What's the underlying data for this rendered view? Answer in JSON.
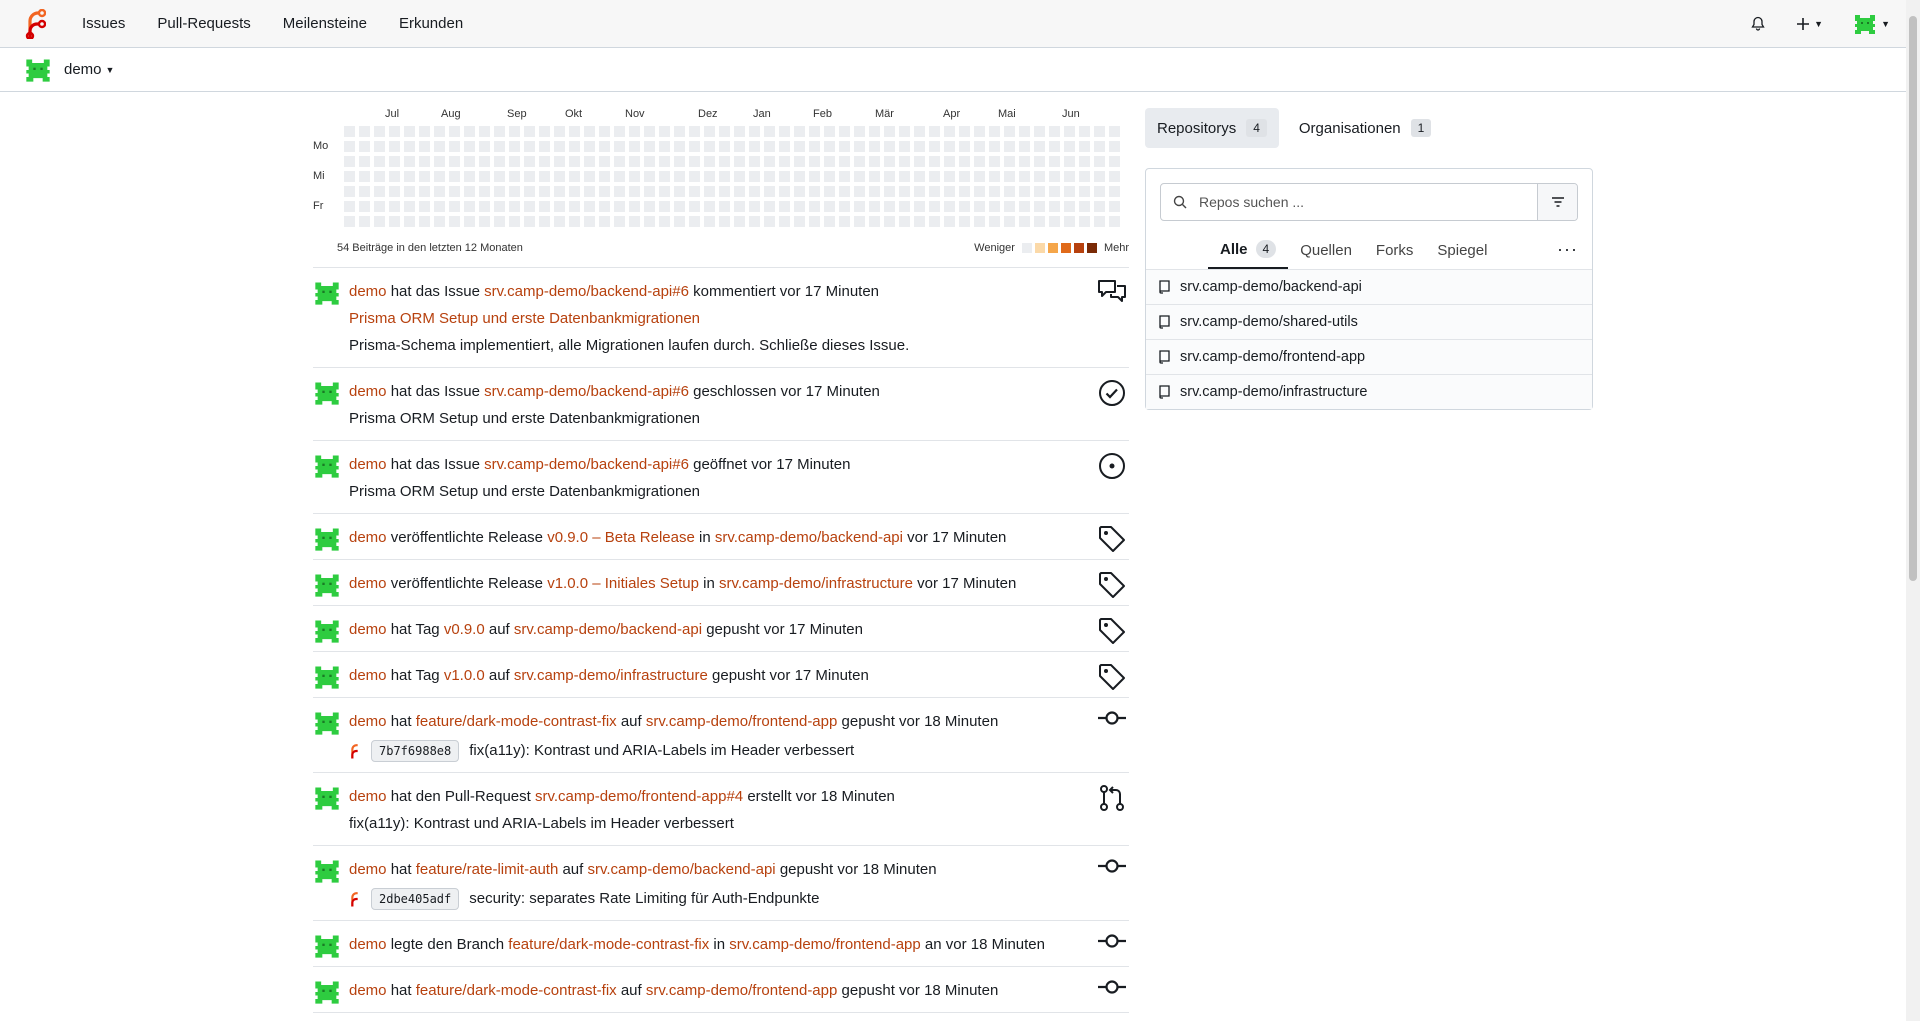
{
  "nav": {
    "items": [
      "Issues",
      "Pull-Requests",
      "Meilensteine",
      "Erkunden"
    ]
  },
  "context": {
    "user": "demo"
  },
  "heatmap": {
    "months": [
      "Jul",
      "Aug",
      "Sep",
      "Okt",
      "Nov",
      "Dez",
      "Jan",
      "Feb",
      "Mär",
      "Apr",
      "Mai",
      "Jun"
    ],
    "days": [
      "Mo",
      "Mi",
      "Fr"
    ],
    "summary": "54 Beiträge in den letzten 12 Monaten",
    "less": "Weniger",
    "more": "Mehr",
    "levels": [
      "#ebedf0",
      "#fbd9a8",
      "#f5a64a",
      "#e06a1a",
      "#b7410e",
      "#7a2a06"
    ],
    "active_cell": {
      "week": 52,
      "day": 5,
      "level": 4
    }
  },
  "feed": [
    {
      "user": "demo",
      "a": "hat das Issue",
      "link1": "srv.camp-demo/backend-api#6",
      "b": "kommentiert vor 17 Minuten",
      "title_link": "Prisma ORM Setup und erste Datenbankmigrationen",
      "body": "Prisma-Schema implementiert, alle Migrationen laufen durch. Schließe dieses Issue.",
      "icon": "comment-discussion-icon"
    },
    {
      "user": "demo",
      "a": "hat das Issue",
      "link1": "srv.camp-demo/backend-api#6",
      "b": "geschlossen vor 17 Minuten",
      "body": "Prisma ORM Setup und erste Datenbankmigrationen",
      "icon": "issue-closed-icon"
    },
    {
      "user": "demo",
      "a": "hat das Issue",
      "link1": "srv.camp-demo/backend-api#6",
      "b": "geöffnet vor 17 Minuten",
      "body": "Prisma ORM Setup und erste Datenbankmigrationen",
      "icon": "issue-opened-icon"
    },
    {
      "user": "demo",
      "a": "veröffentlichte Release",
      "link1": "v0.9.0 – Beta Release",
      "b": "in",
      "link2": "srv.camp-demo/backend-api",
      "c": "vor 17 Minuten",
      "icon": "tag-icon"
    },
    {
      "user": "demo",
      "a": "veröffentlichte Release",
      "link1": "v1.0.0 – Initiales Setup",
      "b": "in",
      "link2": "srv.camp-demo/infrastructure",
      "c": "vor 17 Minuten",
      "icon": "tag-icon"
    },
    {
      "user": "demo",
      "a": "hat Tag",
      "link1": "v0.9.0",
      "b": "auf",
      "link2": "srv.camp-demo/backend-api",
      "c": "gepusht vor 17 Minuten",
      "icon": "tag-icon"
    },
    {
      "user": "demo",
      "a": "hat Tag",
      "link1": "v1.0.0",
      "b": "auf",
      "link2": "srv.camp-demo/infrastructure",
      "c": "gepusht vor 17 Minuten",
      "icon": "tag-icon"
    },
    {
      "user": "demo",
      "a": "hat",
      "link1": "feature/dark-mode-contrast-fix",
      "b": "auf",
      "link2": "srv.camp-demo/frontend-app",
      "c": "gepusht vor 18 Minuten",
      "sha": "7b7f6988e8",
      "commit_msg": "fix(a11y): Kontrast und ARIA-Labels im Header verbessert",
      "icon": "git-commit-icon"
    },
    {
      "user": "demo",
      "a": "hat den Pull-Request",
      "link1": "srv.camp-demo/frontend-app#4",
      "b": "erstellt vor 18 Minuten",
      "body": "fix(a11y): Kontrast und ARIA-Labels im Header verbessert",
      "icon": "git-pull-request-icon"
    },
    {
      "user": "demo",
      "a": "hat",
      "link1": "feature/rate-limit-auth",
      "b": "auf",
      "link2": "srv.camp-demo/backend-api",
      "c": "gepusht vor 18 Minuten",
      "sha": "2dbe405adf",
      "commit_msg": "security: separates Rate Limiting für Auth-Endpunkte",
      "icon": "git-commit-icon"
    },
    {
      "user": "demo",
      "a": "legte den Branch",
      "link1": "feature/dark-mode-contrast-fix",
      "b": "in",
      "link2": "srv.camp-demo/frontend-app",
      "c": "an vor 18 Minuten",
      "icon": "git-commit-icon"
    },
    {
      "user": "demo",
      "a": "hat",
      "link1": "feature/dark-mode-contrast-fix",
      "b": "auf",
      "link2": "srv.camp-demo/frontend-app",
      "c": "gepusht vor 18 Minuten",
      "icon": "git-commit-icon"
    }
  ],
  "sidebar": {
    "tabs": [
      {
        "label": "Repositorys",
        "count": "4"
      },
      {
        "label": "Organisationen",
        "count": "1"
      }
    ],
    "search_placeholder": "Repos suchen ...",
    "subtabs": [
      "Alle",
      "Quellen",
      "Forks",
      "Spiegel"
    ],
    "all_count": "4",
    "repos": [
      "srv.camp-demo/backend-api",
      "srv.camp-demo/shared-utils",
      "srv.camp-demo/frontend-app",
      "srv.camp-demo/infrastructure"
    ]
  },
  "colors": {
    "accent": "#b7410e",
    "avatar": "#2ecc40"
  }
}
